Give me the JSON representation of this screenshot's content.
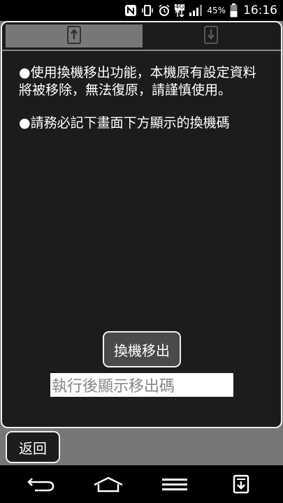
{
  "status_bar": {
    "icons": [
      "nfc-icon",
      "vibrate-icon",
      "alarm-icon",
      "data-4g-icon",
      "signal-icon",
      "battery-icon"
    ],
    "network_label": "4G",
    "battery_percent": "45%",
    "time": "16:16"
  },
  "tabs": [
    {
      "name": "export",
      "icon": "phone-export-icon",
      "active": true
    },
    {
      "name": "import",
      "icon": "phone-import-icon",
      "active": false
    }
  ],
  "notes": [
    "●使用換機移出功能，本機原有設定資料將被移除，無法復原，請謹慎使用。",
    "●請務必記下畫面下方顯示的換機碼"
  ],
  "export_button": "換機移出",
  "code_field": {
    "placeholder": "執行後顯示移出碼"
  },
  "back_button": "返回",
  "nav_bar": {
    "buttons": [
      "back-icon",
      "home-icon",
      "menu-icon",
      "notification-download-icon"
    ]
  },
  "colors": {
    "panel_bg": "#1c1c1c",
    "tab_active": "#777777",
    "border": "#eeeeee",
    "outer_bg": "#777777"
  }
}
